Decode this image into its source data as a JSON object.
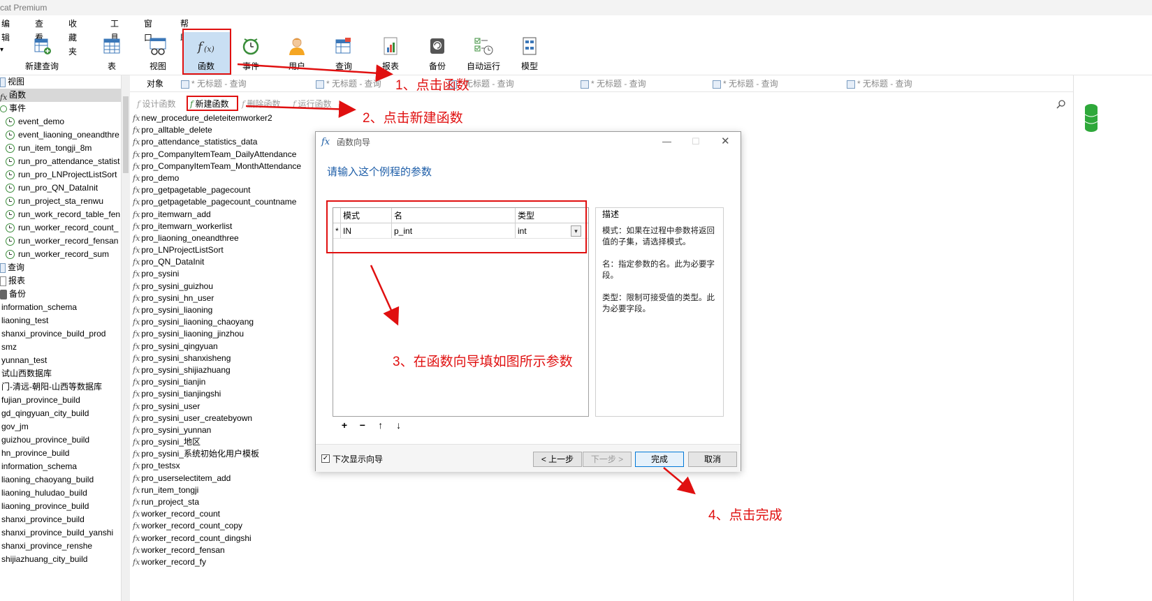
{
  "app": {
    "title": "cat Premium"
  },
  "menu": [
    "编辑",
    "查看",
    "收藏夹",
    "工具",
    "窗口",
    "帮助"
  ],
  "toolbar": [
    {
      "label": "新建查询",
      "icon": "new-query-icon"
    },
    {
      "label": "表",
      "icon": "table-icon"
    },
    {
      "label": "视图",
      "icon": "view-icon"
    },
    {
      "label": "函数",
      "icon": "function-icon"
    },
    {
      "label": "事件",
      "icon": "event-icon"
    },
    {
      "label": "用户",
      "icon": "user-icon"
    },
    {
      "label": "查询",
      "icon": "query-icon"
    },
    {
      "label": "报表",
      "icon": "report-icon"
    },
    {
      "label": "备份",
      "icon": "backup-icon"
    },
    {
      "label": "自动运行",
      "icon": "automation-icon"
    },
    {
      "label": "模型",
      "icon": "model-icon"
    }
  ],
  "sidebar": {
    "nodes": [
      "视图",
      "函数",
      "事件"
    ],
    "events": [
      "event_demo",
      "event_liaoning_oneandthre",
      "run_item_tongji_8m",
      "run_pro_attendance_statist",
      "run_pro_LNProjectListSort",
      "run_pro_QN_DataInit",
      "run_project_sta_renwu",
      "run_work_record_table_fen",
      "run_worker_record_count_",
      "run_worker_record_fensan",
      "run_worker_record_sum"
    ],
    "nodes2": [
      "查询",
      "报表",
      "备份"
    ],
    "databases": [
      "information_schema",
      "liaoning_test",
      "shanxi_province_build_prod",
      "smz",
      "yunnan_test",
      "试山西数据库",
      "门-清远-朝阳-山西等数据库",
      "fujian_province_build",
      "gd_qingyuan_city_build",
      "gov_jm",
      "guizhou_province_build",
      "hn_province_build",
      "information_schema",
      "liaoning_chaoyang_build",
      "liaoning_huludao_build",
      "liaoning_province_build",
      "shanxi_province_build",
      "shanxi_province_build_yanshi",
      "shanxi_province_renshe",
      "shijiazhuang_city_build"
    ]
  },
  "tabs": {
    "object": "对象",
    "untitled": "* 无标题 - 查询"
  },
  "object_toolbar": {
    "design": "设计函数",
    "new": "新建函数",
    "delete": "删除函数",
    "run": "运行函数"
  },
  "procedures": [
    "new_procedure_deleteitemworker2",
    "pro_alltable_delete",
    "pro_attendance_statistics_data",
    "pro_CompanyItemTeam_DailyAttendance",
    "pro_CompanyItemTeam_MonthAttendance",
    "pro_demo",
    "pro_getpagetable_pagecount",
    "pro_getpagetable_pagecount_countname",
    "pro_itemwarn_add",
    "pro_itemwarn_workerlist",
    "pro_liaoning_oneandthree",
    "pro_LNProjectListSort",
    "pro_QN_DataInit",
    "pro_sysini",
    "pro_sysini_guizhou",
    "pro_sysini_hn_user",
    "pro_sysini_liaoning",
    "pro_sysini_liaoning_chaoyang",
    "pro_sysini_liaoning_jinzhou",
    "pro_sysini_qingyuan",
    "pro_sysini_shanxisheng",
    "pro_sysini_shijiazhuang",
    "pro_sysini_tianjin",
    "pro_sysini_tianjingshi",
    "pro_sysini_user",
    "pro_sysini_user_createbyown",
    "pro_sysini_yunnan",
    "pro_sysini_地区",
    "pro_sysini_系统初始化用户模板",
    "pro_testsx",
    "pro_userselectitem_add",
    "run_item_tongji",
    "run_project_sta",
    "worker_record_count",
    "worker_record_count_copy",
    "worker_record_count_dingshi",
    "worker_record_fensan",
    "worker_record_fy"
  ],
  "dialog": {
    "title": "函数向导",
    "heading": "请输入这个例程的参数",
    "columns": {
      "mode": "模式",
      "name": "名",
      "type": "类型"
    },
    "row": {
      "marker": "*",
      "mode": "IN",
      "name": "p_int",
      "type": "int"
    },
    "desc_label": "描述",
    "desc": [
      "模式：如果在过程中参数将返回值的子集，请选择模式。",
      "名：指定参数的名。此为必要字段。",
      "类型：限制可接受值的类型。此为必要字段。"
    ],
    "tools": [
      "+",
      "−",
      "↑",
      "↓"
    ],
    "show_next_time": "下次显示向导",
    "buttons": {
      "prev": "< 上一步",
      "next": "下一步 >",
      "finish": "完成",
      "cancel": "取消"
    }
  },
  "annotations": [
    "1、点击函数",
    "2、点击新建函数",
    "3、在函数向导填如图所示参数",
    "4、点击完成"
  ],
  "colors": {
    "annotation": "#e01010",
    "heading": "#1e5ea8",
    "selected_toolbar": "#c9dff3"
  }
}
